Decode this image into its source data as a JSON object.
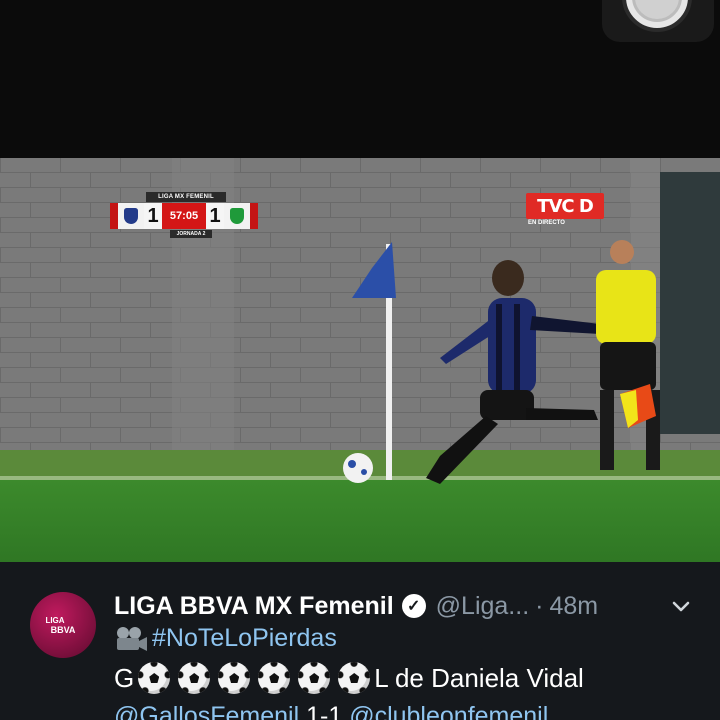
{
  "video": {
    "scorebug": {
      "league": "LIGA MX FEMENIL",
      "home_score": "1",
      "time": "57:05",
      "away_score": "1",
      "round": "JORNADA 2"
    },
    "broadcaster": {
      "logo": "TVC D",
      "live": "EN DIRECTO"
    }
  },
  "tweet": {
    "account_name": "LIGA BBVA MX Femenil",
    "handle": "@Liga...",
    "separator": "·",
    "timestamp": "48m",
    "avatar_text_1": "LIGA",
    "avatar_text_2": "BBVA",
    "hashtag": "#NoTeLoPierdas",
    "goal_prefix": "G",
    "goal_suffix": "L de Daniela Vidal",
    "line4_mention_1": "@GallosFemenil",
    "line4_score": " 1-1 ",
    "line4_mention_2": "@clubleonfemenil"
  },
  "icons": {
    "verified": "verified-badge-icon",
    "chevron": "chevron-down-icon",
    "camera": "movie-camera-icon",
    "ball": "soccer-ball-icon"
  },
  "colors": {
    "tweet_bg": "#15181c",
    "link": "#8fc5f0",
    "muted": "#8b98a5",
    "scorebug_red": "#d41616",
    "home_crest": "#233b8a",
    "away_crest": "#1f9a3a"
  }
}
